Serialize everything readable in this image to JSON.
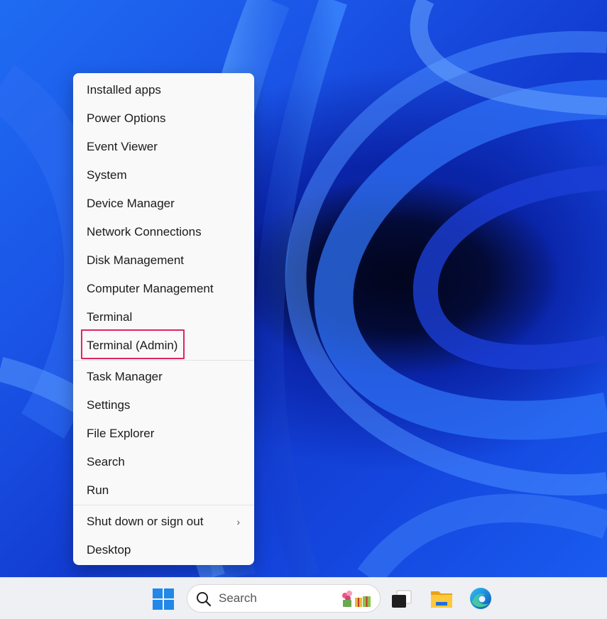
{
  "context_menu": {
    "items": [
      {
        "label": "Installed apps"
      },
      {
        "label": "Power Options"
      },
      {
        "label": "Event Viewer"
      },
      {
        "label": "System"
      },
      {
        "label": "Device Manager"
      },
      {
        "label": "Network Connections"
      },
      {
        "label": "Disk Management"
      },
      {
        "label": "Computer Management"
      },
      {
        "label": "Terminal"
      },
      {
        "label": "Terminal (Admin)",
        "highlighted": true
      },
      {
        "label": "Task Manager"
      },
      {
        "label": "Settings"
      },
      {
        "label": "File Explorer"
      },
      {
        "label": "Search"
      },
      {
        "label": "Run"
      },
      {
        "label": "Shut down or sign out",
        "submenu": true
      },
      {
        "label": "Desktop"
      }
    ],
    "submenu_glyph": "›",
    "highlight_color": "#e12467"
  },
  "taskbar": {
    "search_label": "Search",
    "icons": [
      "windows-start-icon",
      "search-icon",
      "search-highlight-icon",
      "task-view-icon",
      "file-explorer-icon",
      "edge-browser-icon"
    ]
  },
  "colors": {
    "menu_background": "#f9f9f9",
    "taskbar_background": "#eef0f3",
    "wallpaper_blue": "#1446de",
    "windows_blue": "#2187e8"
  }
}
